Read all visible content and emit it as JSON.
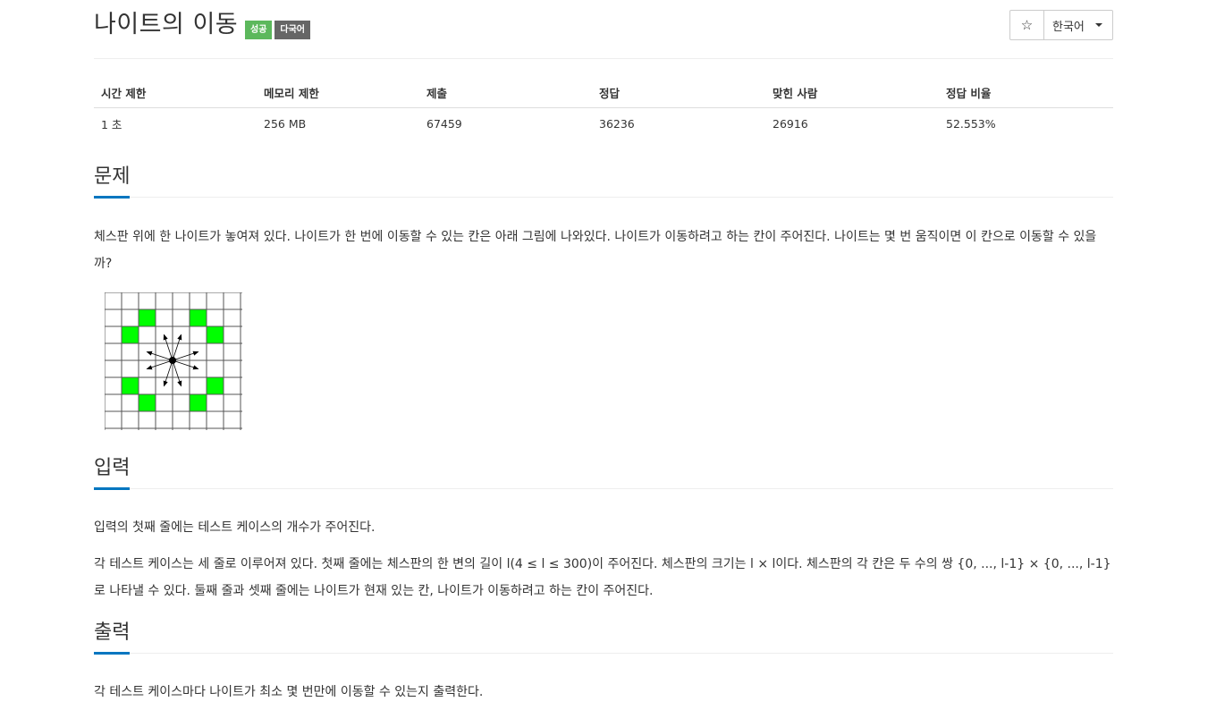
{
  "problem": {
    "title": "나이트의 이동",
    "badges": [
      "성공",
      "다국어"
    ]
  },
  "toolbar": {
    "star_icon": "☆",
    "language": "한국어"
  },
  "stats": {
    "headers": [
      "시간 제한",
      "메모리 제한",
      "제출",
      "정답",
      "맞힌 사람",
      "정답 비율"
    ],
    "values": [
      "1 초",
      "256 MB",
      "67459",
      "36236",
      "26916",
      "52.553%"
    ]
  },
  "sections": {
    "problem": {
      "heading": "문제",
      "text": "체스판 위에 한 나이트가 놓여져 있다. 나이트가 한 번에 이동할 수 있는 칸은 아래 그림에 나와있다. 나이트가 이동하려고 하는 칸이 주어진다. 나이트는 몇 번 움직이면 이 칸으로 이동할 수 있을까?"
    },
    "input": {
      "heading": "입력",
      "text1": "입력의 첫째 줄에는 테스트 케이스의 개수가 주어진다.",
      "text2": "각 테스트 케이스는 세 줄로 이루어져 있다. 첫째 줄에는 체스판의 한 변의 길이 l(4 ≤ l ≤ 300)이 주어진다. 체스판의 크기는 l × l이다. 체스판의 각 칸은 두 수의 쌍 {0, ..., l-1} × {0, ..., l-1}로 나타낼 수 있다. 둘째 줄과 셋째 줄에는 나이트가 현재 있는 칸, 나이트가 이동하려고 하는 칸이 주어진다."
    },
    "output": {
      "heading": "출력",
      "text": "각 테스트 케이스마다 나이트가 최소 몇 번만에 이동할 수 있는지 출력한다."
    }
  },
  "colors": {
    "accent": "#0076c0",
    "badge_success": "#5cb85c",
    "badge_multilang": "#666666",
    "knight_target": "#00ff00"
  }
}
